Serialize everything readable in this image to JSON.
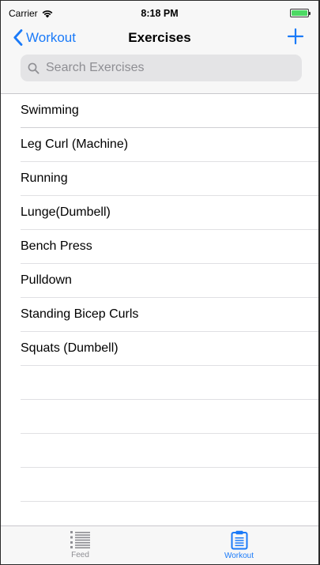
{
  "status_bar": {
    "carrier": "Carrier",
    "time": "8:18 PM",
    "battery_level": 1.0
  },
  "nav": {
    "back_label": "Workout",
    "title": "Exercises",
    "add_icon": "plus-icon",
    "back_icon": "chevron-left-icon"
  },
  "search": {
    "placeholder": "Search Exercises",
    "value": "",
    "icon": "search-icon"
  },
  "exercises": [
    "Swimming",
    "Leg Curl (Machine)",
    "Running",
    "Lunge(Dumbell)",
    "Bench Press",
    "Pulldown",
    "Standing Bicep Curls",
    "Squats (Dumbell)"
  ],
  "tabs": [
    {
      "label": "Feed",
      "icon": "list-icon",
      "active": false
    },
    {
      "label": "Workout",
      "icon": "clipboard-icon",
      "active": true
    }
  ],
  "colors": {
    "accent": "#1a7af8",
    "inactive": "#8e8e93",
    "battery": "#4cd964"
  }
}
